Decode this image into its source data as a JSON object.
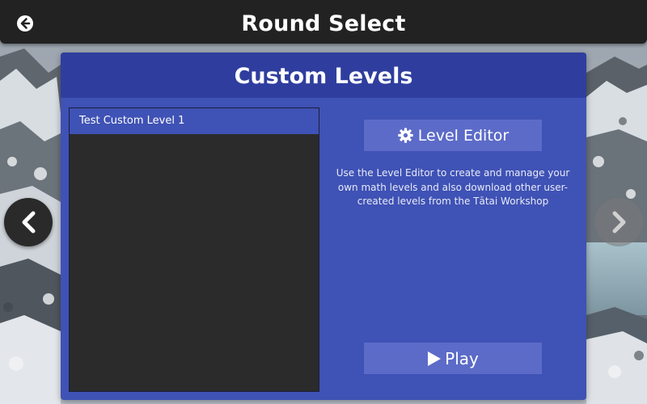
{
  "header": {
    "title": "Round Select",
    "back_icon": "back-arrow-circle-icon"
  },
  "panel": {
    "title": "Custom Levels",
    "levels": [
      {
        "label": "Test Custom Level 1",
        "selected": true
      }
    ],
    "level_editor_button": {
      "label": "Level Editor",
      "icon": "gear-icon"
    },
    "description": "Use the Level Editor to create and manage your own math levels and also download other user-created levels from the Tātai Workshop",
    "play_button": {
      "label": "Play",
      "icon": "play-icon"
    }
  },
  "navigation": {
    "prev_icon": "chevron-left-icon",
    "next_icon": "chevron-right-icon",
    "next_enabled": false
  },
  "colors": {
    "topbar": "#222222",
    "panel": "#3f52b5",
    "panel_header": "#2f3e9e",
    "button": "#5c6bc8",
    "list_bg": "#2b2b2b"
  }
}
